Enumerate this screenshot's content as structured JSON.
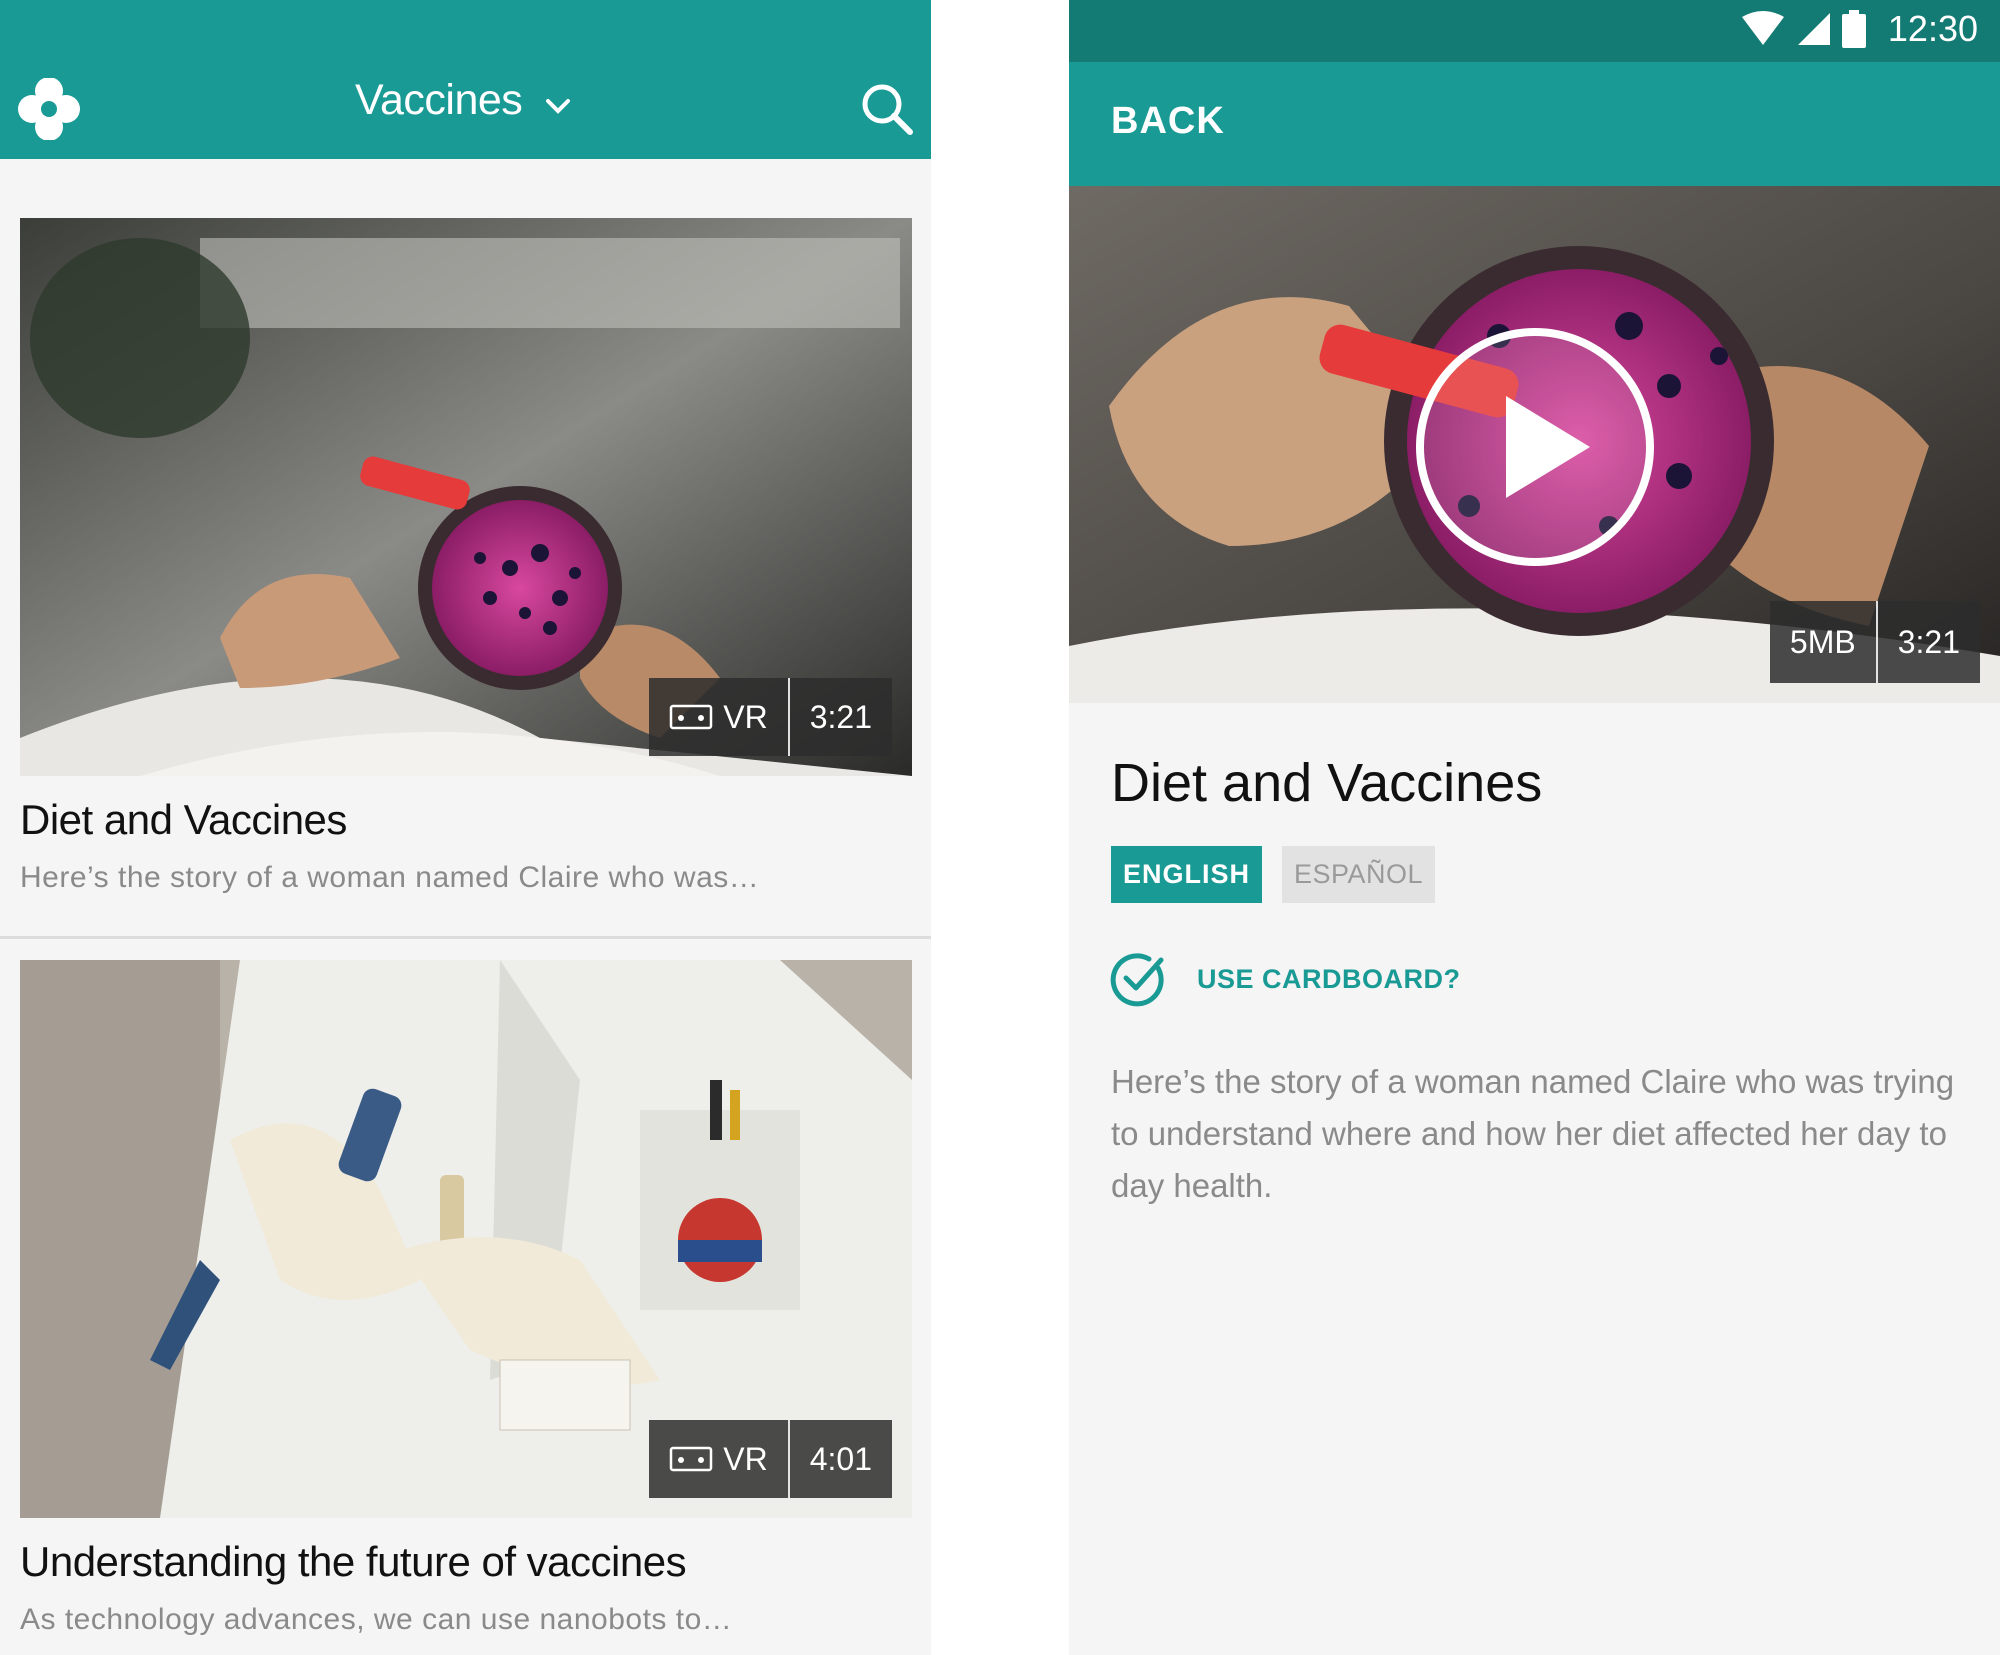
{
  "left": {
    "header": {
      "title": "Vaccines"
    },
    "cards": [
      {
        "title": "Diet and Vaccines",
        "description": "Here’s the story of a woman named Claire who was…",
        "vr_label": "VR",
        "duration": "3:21"
      },
      {
        "title": "Understanding the future of vaccines",
        "description": "As technology advances, we can use nanobots to…",
        "vr_label": "VR",
        "duration": "4:01"
      }
    ]
  },
  "right": {
    "status_bar": {
      "time": "12:30"
    },
    "appbar": {
      "back_label": "BACK"
    },
    "video": {
      "size": "5MB",
      "duration": "3:21"
    },
    "title": "Diet and Vaccines",
    "languages": [
      {
        "label": "ENGLISH",
        "selected": true
      },
      {
        "label": "ESPAÑOL",
        "selected": false
      }
    ],
    "cardboard_label": "USE CARDBOARD?",
    "cardboard_checked": true,
    "description": "Here’s the story of a woman named Claire who was trying to understand where and how her diet affected her day to day health."
  },
  "colors": {
    "teal": "#1a9a94",
    "teal_dark": "#137a74",
    "background": "#f5f5f5"
  }
}
